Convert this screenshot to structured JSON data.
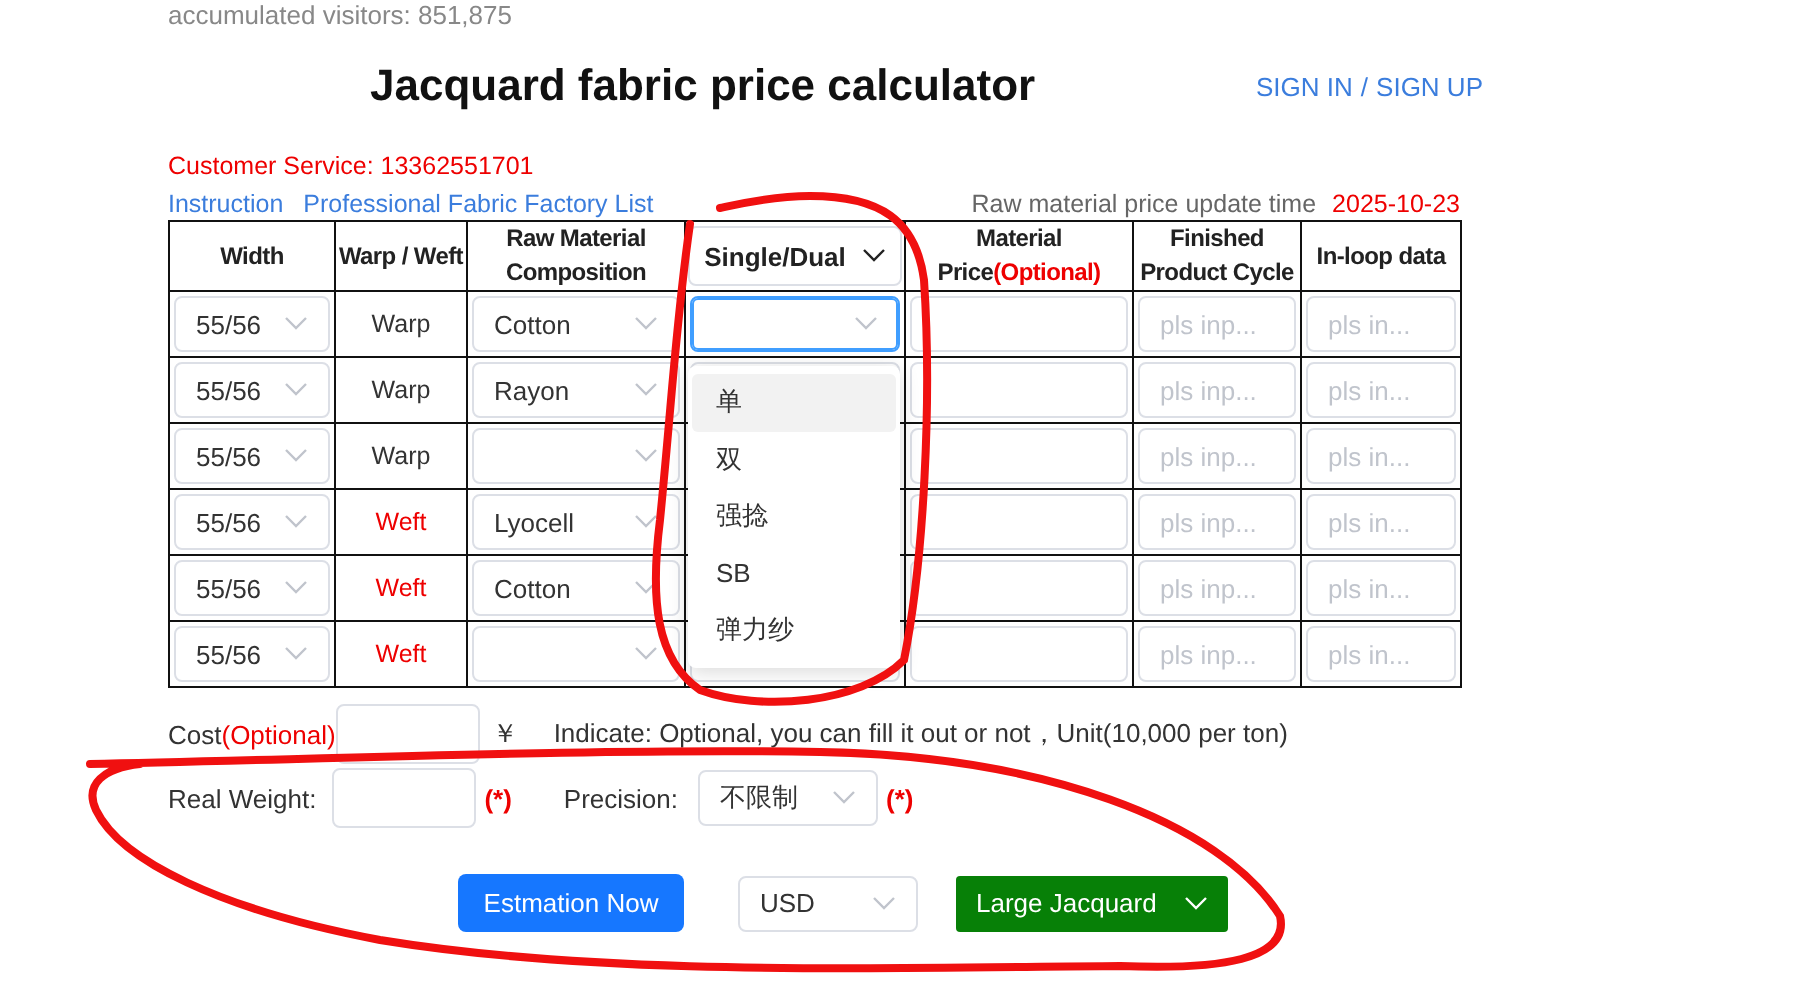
{
  "visitors": {
    "label": "accumulated visitors:",
    "count": "851,875"
  },
  "title": "Jacquard fabric price calculator",
  "auth": {
    "sign_in": "SIGN IN",
    "separator": "/",
    "sign_up": "SIGN UP"
  },
  "customer_service": "Customer Service: 13362551701",
  "links": [
    "Instruction",
    "Professional Fabric Factory List"
  ],
  "update": {
    "label": "Raw material price update time",
    "date": "2025-10-23"
  },
  "table": {
    "columns": [
      {
        "label": "Width",
        "kind": "text"
      },
      {
        "label": "Warp / Weft",
        "kind": "text"
      },
      {
        "label": "Raw Material Composition",
        "kind": "text"
      },
      {
        "label": "Single/Dual",
        "kind": "dropdown"
      },
      {
        "label": "Material Price",
        "note": "(Optional)",
        "kind": "text"
      },
      {
        "label": "Finished Product Cycle",
        "kind": "text"
      },
      {
        "label": "In-loop data",
        "kind": "text"
      }
    ],
    "rows": [
      {
        "width": "55/56",
        "side": {
          "text": "Warp",
          "kind": "warp"
        },
        "material": "Cotton",
        "single_dual_focused": true,
        "cycle_placeholder": "pls inp...",
        "loop_placeholder": "pls in..."
      },
      {
        "width": "55/56",
        "side": {
          "text": "Warp",
          "kind": "warp"
        },
        "material": "Rayon",
        "single_dual_focused": false,
        "cycle_placeholder": "pls inp...",
        "loop_placeholder": "pls in..."
      },
      {
        "width": "55/56",
        "side": {
          "text": "Warp",
          "kind": "warp"
        },
        "cycle_placeholder": "pls inp...",
        "loop_placeholder": "pls in..."
      },
      {
        "width": "55/56",
        "side": {
          "text": "Weft",
          "kind": "weft"
        },
        "material": "Lyocell",
        "cycle_placeholder": "pls inp...",
        "loop_placeholder": "pls in..."
      },
      {
        "width": "55/56",
        "side": {
          "text": "Weft",
          "kind": "weft"
        },
        "material": "Cotton",
        "cycle_placeholder": "pls inp...",
        "loop_placeholder": "pls in..."
      },
      {
        "width": "55/56",
        "side": {
          "text": "Weft",
          "kind": "weft"
        },
        "single_dual_focused": false,
        "cycle_placeholder": "pls inp...",
        "loop_placeholder": "pls in..."
      }
    ]
  },
  "dropdown_menu": [
    {
      "label": "单",
      "highlighted": true
    },
    {
      "label": "双",
      "highlighted": false
    },
    {
      "label": "强捻",
      "highlighted": false
    },
    {
      "label": "SB",
      "highlighted": false
    },
    {
      "label": "弹力纱",
      "highlighted": false
    }
  ],
  "cost": {
    "label": "Cost",
    "note": "(Optional)",
    "unit": "￥",
    "hint": "Indicate: Optional, you can fill it out or not，Unit(10,000 per ton)"
  },
  "real_weight": {
    "label": "Real Weight:",
    "required": "(*)"
  },
  "precision": {
    "label": "Precision:",
    "value": "不限制",
    "required": "(*)"
  },
  "actions": {
    "estimate": "Estmation Now",
    "currency": "USD",
    "fabric_type": "Large Jacquard"
  }
}
